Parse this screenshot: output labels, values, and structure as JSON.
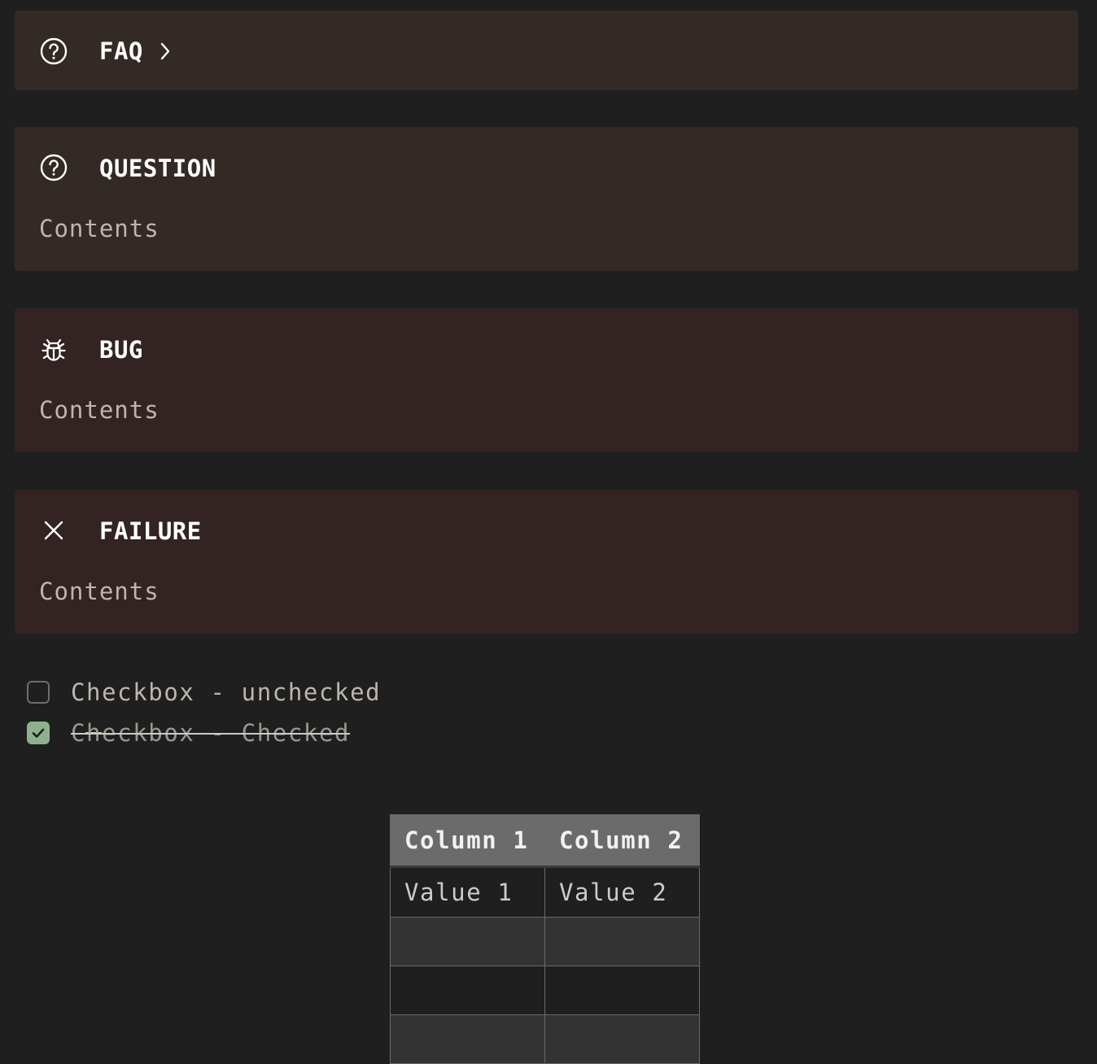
{
  "callouts": [
    {
      "type": "faq",
      "icon": "question-circle-icon",
      "title": "FAQ",
      "collapsed": true,
      "body": ""
    },
    {
      "type": "question",
      "icon": "question-circle-icon",
      "title": "QUESTION",
      "body": "Contents"
    },
    {
      "type": "bug",
      "icon": "bug-icon",
      "title": "BUG",
      "body": "Contents"
    },
    {
      "type": "failure",
      "icon": "x-icon",
      "title": "FAILURE",
      "body": "Contents"
    }
  ],
  "tasks": [
    {
      "label": "Checkbox - unchecked",
      "checked": false
    },
    {
      "label": "Checkbox - Checked",
      "checked": true
    }
  ],
  "table": {
    "headers": [
      "Column 1",
      "Column 2"
    ],
    "rows": [
      [
        "Value 1",
        "Value 2"
      ],
      [
        "",
        ""
      ],
      [
        "",
        ""
      ],
      [
        "",
        ""
      ]
    ]
  },
  "colors": {
    "background": "#1f1f1f",
    "question_callout_bg": "#332a25",
    "danger_callout_bg": "#332323",
    "checkbox_checked": "#8fb08f",
    "table_header_bg": "#6b6b6b"
  }
}
